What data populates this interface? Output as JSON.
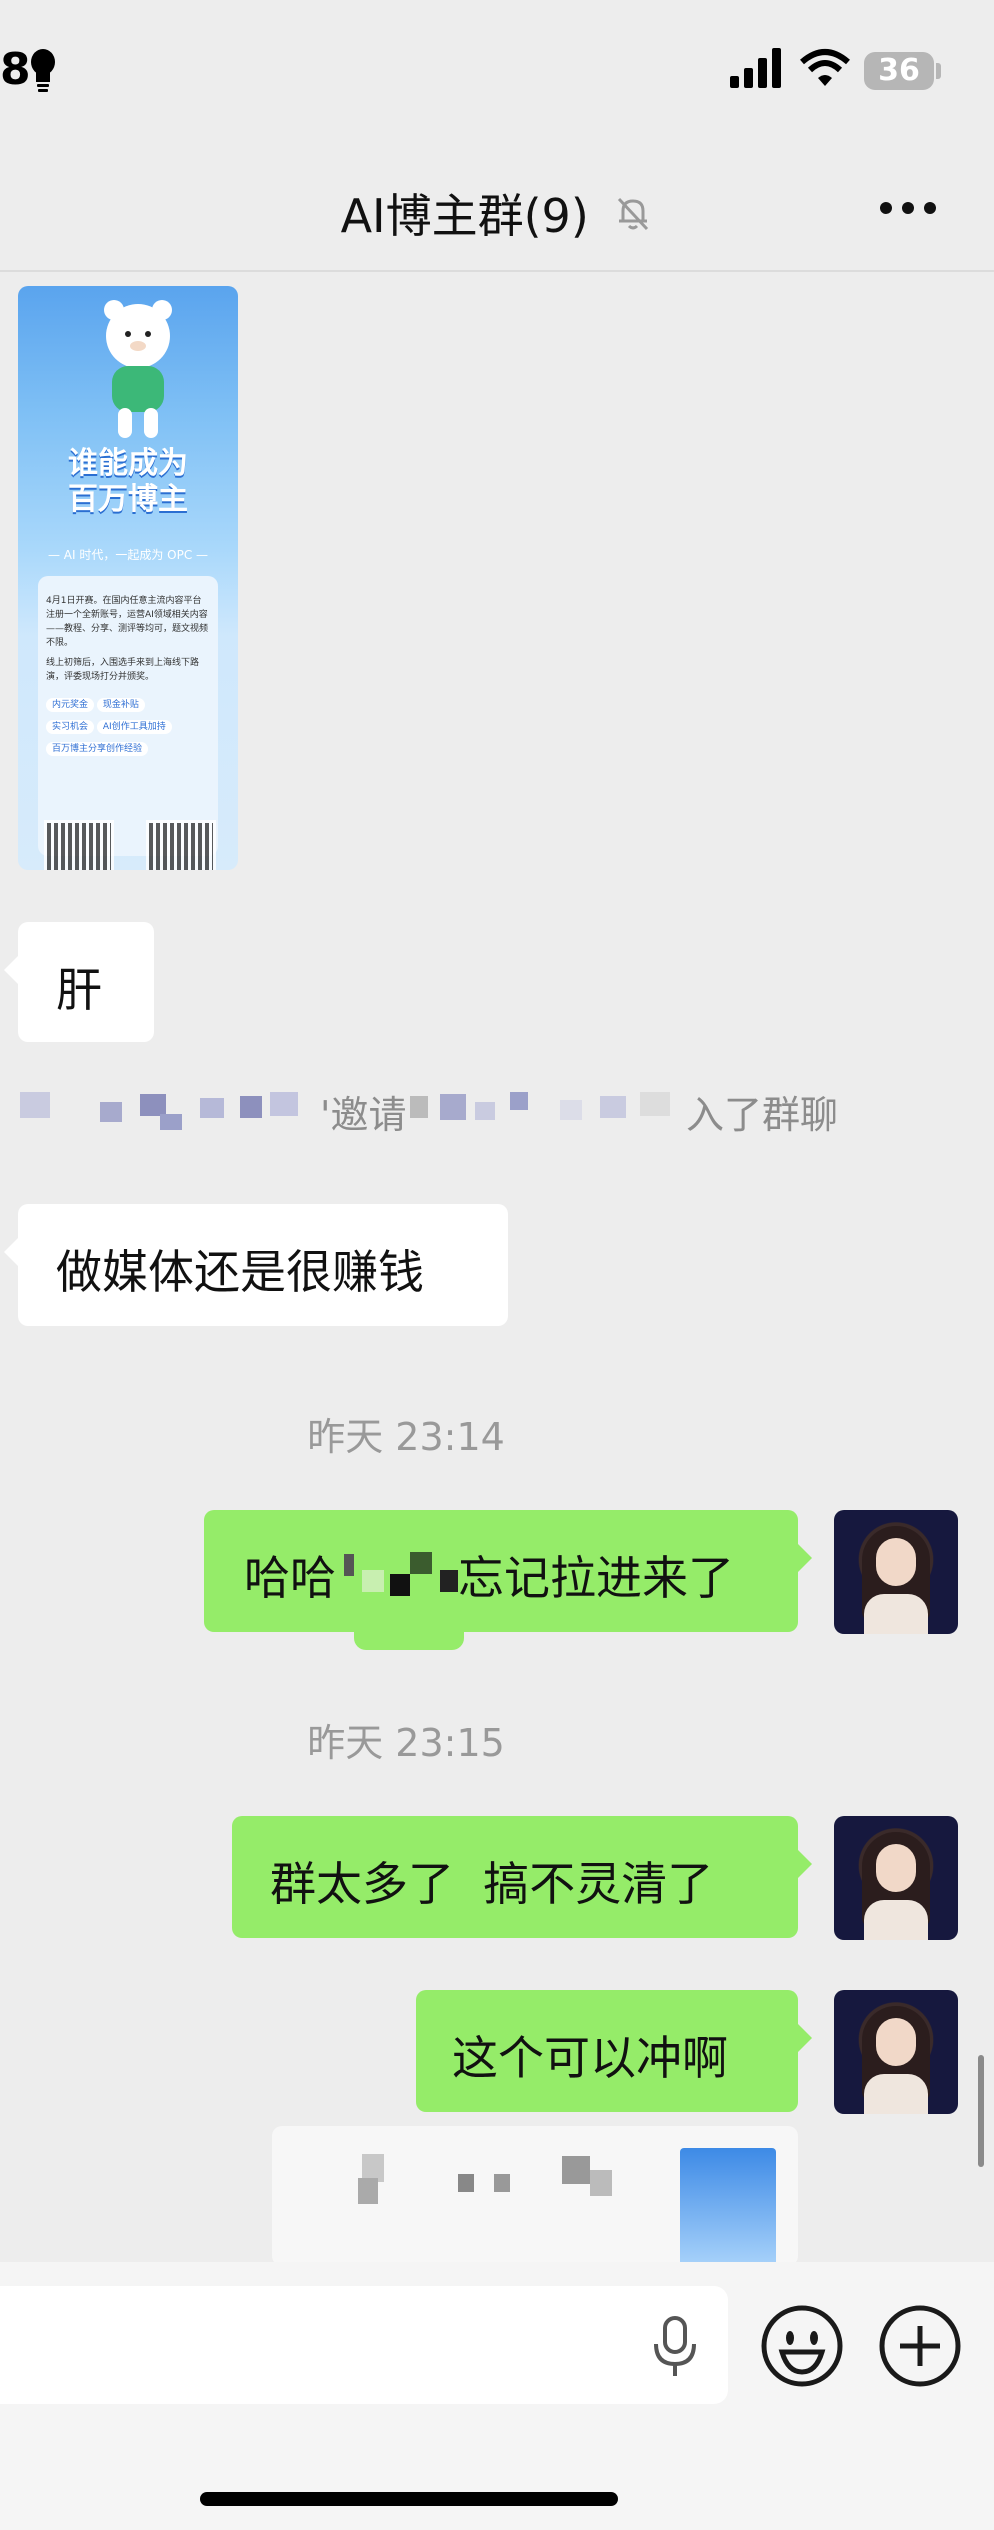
{
  "status_bar": {
    "time": "8",
    "battery": "36",
    "icons": [
      "bulb-icon",
      "signal-icon",
      "wifi-icon",
      "battery-icon"
    ]
  },
  "nav": {
    "title": "AI博主群(9)",
    "icons": [
      "mute-bell-icon",
      "more-icon"
    ]
  },
  "messages": {
    "poster": {
      "title_line1": "谁能成为",
      "title_line2": "百万博主",
      "subtitle": "— AI 时代，一起成为 OPC —",
      "intro": "4月1日开赛。在国内任意主流内容平台注册一个全新账号，运营AI领域相关内容——教程、分享、测评等均可，题文视频不限。",
      "intro2": "线上初筛后，入围选手来到上海线下路演，评委现场打分并颁奖。",
      "bullets": [
        "内元奖金",
        "现金补贴",
        "实习机会",
        "AI创作工具加持",
        "百万博主分享创作经验"
      ]
    },
    "msg1": "肝",
    "system_left": "'邀请",
    "system_right": "入了群聊",
    "msg2": "做媒体还是很赚钱",
    "time1": "昨天 23:14",
    "msg3_a": "哈哈",
    "msg3_b": "忘记拉进来了",
    "time2": "昨天 23:15",
    "msg4": "群太多了  搞不灵清了",
    "msg5": "这个可以冲啊"
  },
  "input": {
    "icons": [
      "voice-icon",
      "emoji-icon",
      "plus-icon"
    ]
  }
}
